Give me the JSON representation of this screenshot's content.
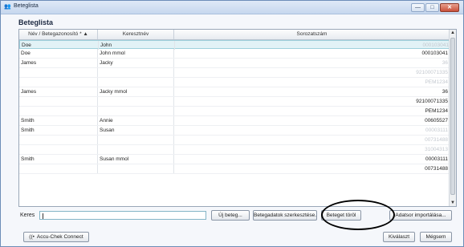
{
  "window": {
    "title": "Beteglista",
    "controls": [
      "—",
      "□",
      "✕"
    ]
  },
  "heading": "Beteglista",
  "table": {
    "columns": [
      "Név / Betegazonosító * ▲",
      "Keresztnév",
      "Sorozatszám"
    ],
    "rows": [
      {
        "last": "Doe",
        "first": "John",
        "serial": "000103041",
        "faded": true,
        "selected": true
      },
      {
        "last": "Doe",
        "first": "John mmol",
        "serial": "000103041",
        "faded": false
      },
      {
        "last": "James",
        "first": "Jacky",
        "serial": "36",
        "faded": true
      },
      {
        "last": "",
        "first": "",
        "serial": "92100071335",
        "faded": true
      },
      {
        "last": "",
        "first": "",
        "serial": "PEM1234",
        "faded": true
      },
      {
        "last": "James",
        "first": "Jacky mmol",
        "serial": "36",
        "faded": false
      },
      {
        "last": "",
        "first": "",
        "serial": "92100071335",
        "faded": false
      },
      {
        "last": "",
        "first": "",
        "serial": "PEM1234",
        "faded": false
      },
      {
        "last": "Smith",
        "first": "Annie",
        "serial": "00605527",
        "faded": false
      },
      {
        "last": "Smith",
        "first": "Susan",
        "serial": "00003111",
        "faded": true
      },
      {
        "last": "",
        "first": "",
        "serial": "00731488",
        "faded": true
      },
      {
        "last": "",
        "first": "",
        "serial": "31004313",
        "faded": true
      },
      {
        "last": "Smith",
        "first": "Susan mmol",
        "serial": "00003111",
        "faded": false
      },
      {
        "last": "",
        "first": "",
        "serial": "00731488",
        "faded": false
      }
    ]
  },
  "search": {
    "label": "Keres",
    "value": ""
  },
  "buttons": {
    "new_patient": "Új beteg...",
    "edit_patient": "Betegadatok szerkesztése...",
    "delete_patient": "Beteget töröl",
    "import_data": "Adatsor importálása...",
    "accu_chek": "Accu-Chek Connect",
    "select": "Kiválaszt",
    "cancel": "Mégsem"
  }
}
